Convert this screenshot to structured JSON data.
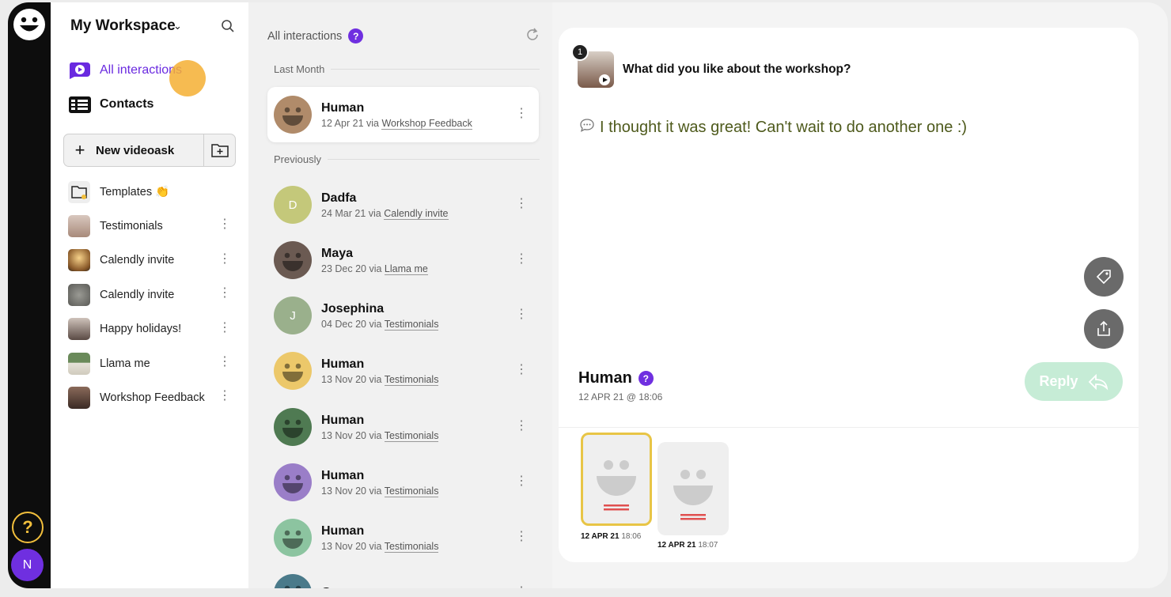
{
  "sidebar": {
    "workspace": "My Workspace",
    "nav": [
      {
        "label": "All interactions",
        "icon": "play-bubble-icon",
        "active": true
      },
      {
        "label": "Contacts",
        "icon": "contacts-icon",
        "active": false
      }
    ],
    "new_button": "New videoask",
    "folders": [
      {
        "label": "Templates 👏",
        "icon": "folder-icon"
      },
      {
        "label": "Testimonials"
      },
      {
        "label": "Calendly invite"
      },
      {
        "label": "Calendly invite"
      },
      {
        "label": "Happy holidays!"
      },
      {
        "label": "Llama me"
      },
      {
        "label": "Workshop Feedback"
      }
    ]
  },
  "list": {
    "title": "All interactions",
    "help": "?",
    "sections": [
      {
        "label": "Last Month"
      },
      {
        "label": "Previously"
      }
    ],
    "entries": [
      {
        "initial": "",
        "name": "Human",
        "date": "12 Apr 21 via ",
        "source": "Workshop Feedback",
        "color": "#b08b6a"
      },
      {
        "initial": "D",
        "name": "Dadfa",
        "date": "24 Mar 21 via ",
        "source": "Calendly invite",
        "color": "#c4c87a"
      },
      {
        "initial": "",
        "name": "Maya",
        "date": "23 Dec 20 via ",
        "source": "Llama me",
        "color": "#6b5a52"
      },
      {
        "initial": "J",
        "name": "Josephina",
        "date": "04 Dec 20 via ",
        "source": "Testimonials",
        "color": "#9ab08c"
      },
      {
        "initial": "",
        "name": "Human",
        "date": "13 Nov 20 via ",
        "source": "Testimonials",
        "color": "#ecc86a"
      },
      {
        "initial": "",
        "name": "Human",
        "date": "13 Nov 20 via ",
        "source": "Testimonials",
        "color": "#4f7a52"
      },
      {
        "initial": "",
        "name": "Human",
        "date": "13 Nov 20 via ",
        "source": "Testimonials",
        "color": "#9a7ec8"
      },
      {
        "initial": "",
        "name": "Human",
        "date": "13 Nov 20 via ",
        "source": "Testimonials",
        "color": "#8cc4a0"
      },
      {
        "initial": "",
        "name": "George",
        "date": "",
        "source": "",
        "color": "#4a7a8a"
      }
    ]
  },
  "detail": {
    "question_number": "1",
    "question": "What did you like about the workshop?",
    "answer": "I thought it was great! Can't wait to do another one :)",
    "contact_name": "Human",
    "contact_help": "?",
    "timestamp": "12 APR 21 @ 18:06",
    "reply_label": "Reply",
    "clips": [
      {
        "date": "12 APR 21",
        "time": "18:06"
      },
      {
        "date": "12 APR 21",
        "time": "18:07"
      }
    ]
  },
  "rail": {
    "help": "?",
    "user_initial": "N"
  },
  "colors": {
    "accent": "#6f2fe0",
    "rail": "#0d0d0d",
    "reply": "#c6ecd6",
    "answer_text": "#4e5a1c",
    "highlight": "#e8c546"
  }
}
